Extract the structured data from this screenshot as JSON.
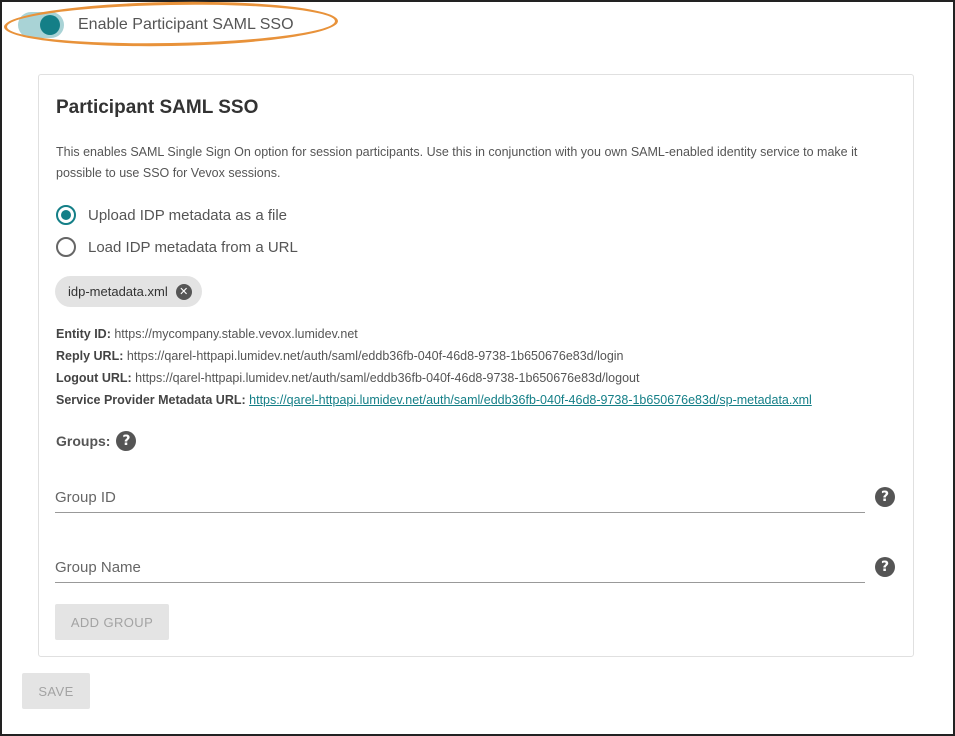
{
  "toggle": {
    "label": "Enable Participant SAML SSO",
    "state": "on",
    "accent": "#147f87"
  },
  "card": {
    "title": "Participant SAML SSO",
    "description": "This enables SAML Single Sign On option for session participants. Use this in conjunction with you own SAML-enabled identity service to make it possible to use SSO for Vevox sessions.",
    "options": [
      {
        "label": "Upload IDP metadata as a file",
        "selected": true
      },
      {
        "label": "Load IDP metadata from a URL",
        "selected": false
      }
    ],
    "file_chip": {
      "label": "idp-metadata.xml",
      "remove_icon": "close-circle-icon"
    },
    "info": {
      "entity_id_label": "Entity ID:",
      "entity_id_value": "https://mycompany.stable.vevox.lumidev.net",
      "reply_url_label": "Reply URL:",
      "reply_url_value": "https://qarel-httpapi.lumidev.net/auth/saml/eddb36fb-040f-46d8-9738-1b650676e83d/login",
      "logout_url_label": "Logout URL:",
      "logout_url_value": "https://qarel-httpapi.lumidev.net/auth/saml/eddb36fb-040f-46d8-9738-1b650676e83d/logout",
      "sp_metadata_label": "Service Provider Metadata URL:",
      "sp_metadata_value": "https://qarel-httpapi.lumidev.net/auth/saml/eddb36fb-040f-46d8-9738-1b650676e83d/sp-metadata.xml"
    },
    "groups": {
      "label": "Groups:",
      "help_glyph": "?",
      "group_id_placeholder": "Group ID",
      "group_name_placeholder": "Group Name",
      "add_button": "ADD GROUP"
    }
  },
  "save_button": "SAVE"
}
